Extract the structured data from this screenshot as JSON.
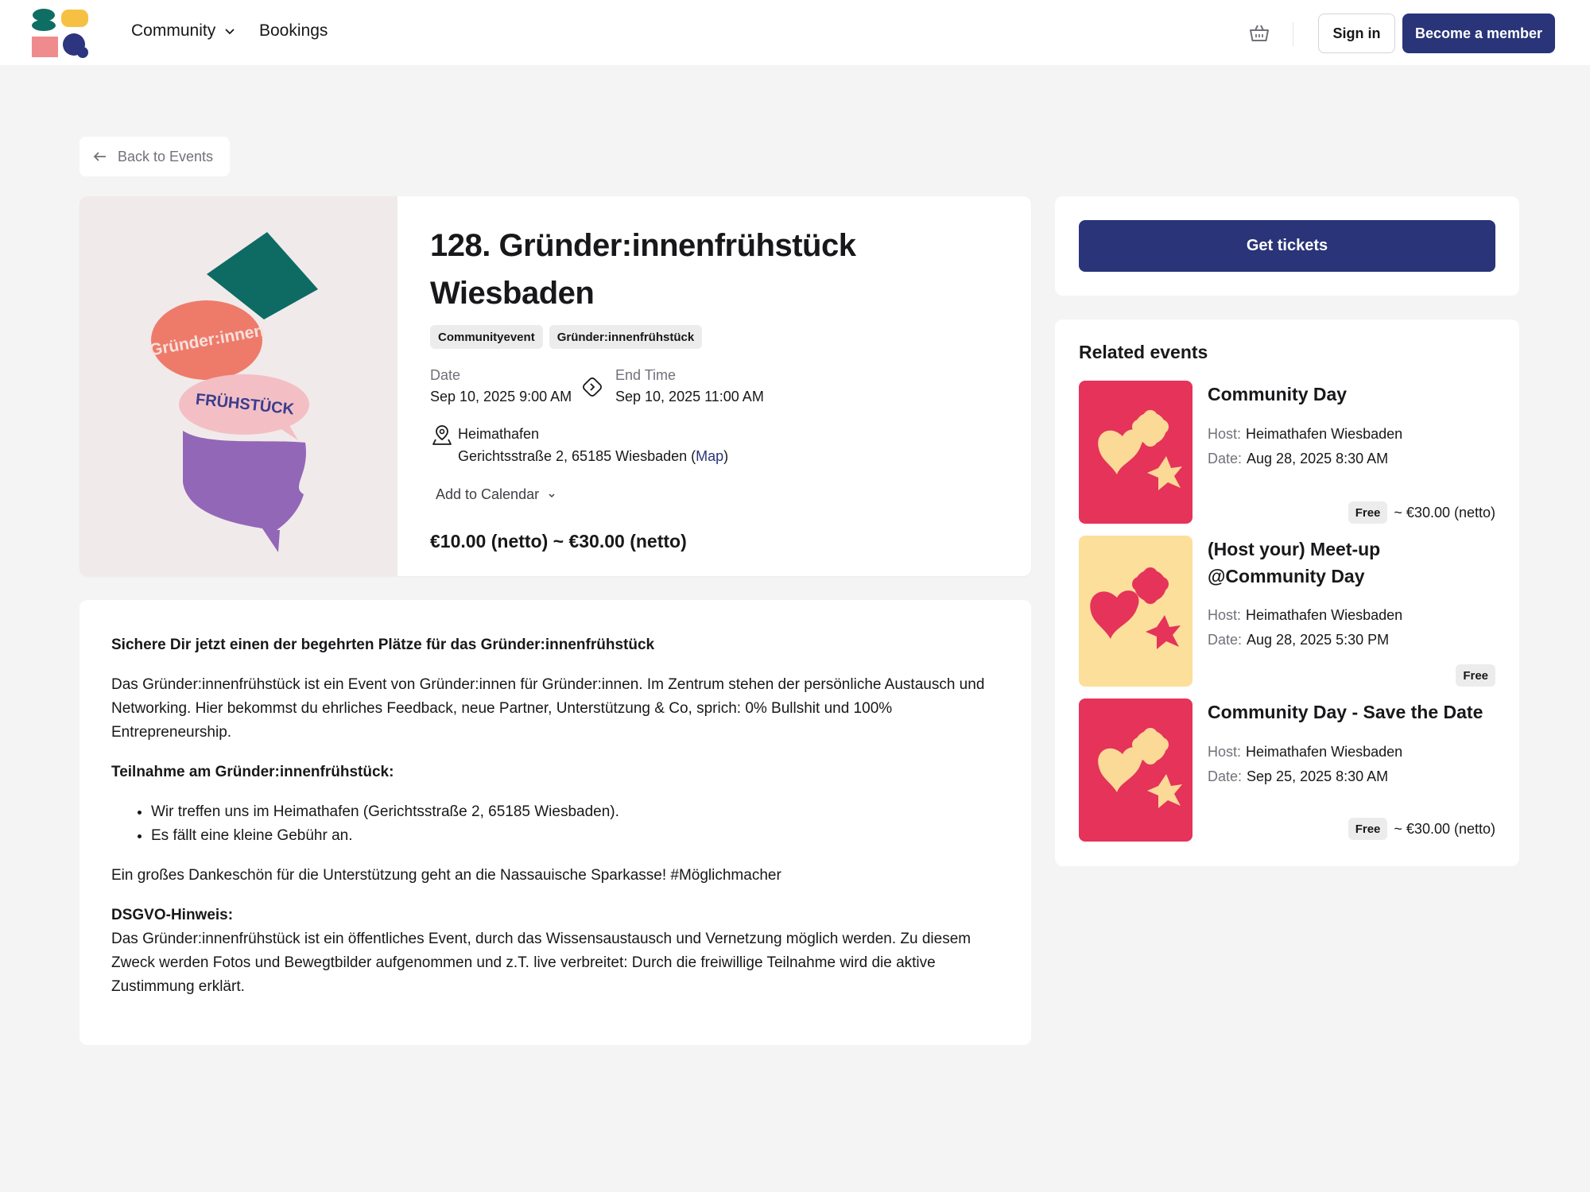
{
  "header": {
    "nav": {
      "community": "Community",
      "bookings": "Bookings"
    },
    "signin": "Sign in",
    "member": "Become a member"
  },
  "back": "Back to Events",
  "event": {
    "title": "128. Gründer:innenfrühstück Wiesbaden",
    "image_text": {
      "top": "Gründer:innen",
      "bottom": "FRÜHSTÜCK"
    },
    "tags": [
      "Communityevent",
      "Gründer:innenfrühstück"
    ],
    "date_label": "Date",
    "date_value": "Sep 10, 2025 9:00 AM",
    "end_label": "End Time",
    "end_value": "Sep 10, 2025 11:00 AM",
    "location_name": "Heimathafen",
    "location_address": "Gerichtsstraße 2, 65185 Wiesbaden (",
    "map_link": "Map",
    "location_close": ")",
    "add_to_calendar": "Add to Calendar",
    "price": "€10.00 (netto) ~ €30.00 (netto)"
  },
  "description": {
    "heading": "Sichere Dir jetzt einen der begehrten Plätze für das Gründer:innenfrühstück",
    "intro": "Das Gründer:innenfrühstück ist ein Event von Gründer:innen für Gründer:innen. Im Zentrum stehen der persönliche Austausch und Networking. Hier bekommst du ehrliches Feedback, neue Partner, Unterstützung & Co, sprich: 0% Bullshit und 100% Entrepreneurship.",
    "participation_heading": "Teilnahme am Gründer:innenfrühstück:",
    "bullets": [
      "Wir treffen uns im Heimathafen (Gerichtsstraße 2, 65185 Wiesbaden).",
      "Es fällt eine kleine Gebühr an."
    ],
    "thanks": "Ein großes Dankeschön für die Unterstützung geht an die Nassauische Sparkasse! #Möglichmacher",
    "dsgvo_heading": "DSGVO-Hinweis:",
    "dsgvo_text": "Das Gründer:innenfrühstück ist ein öffentliches Event, durch das Wissensaustausch und Vernetzung möglich werden. Zu diesem Zweck werden Fotos und Bewegtbilder aufgenommen und z.T. live verbreitet: Durch die freiwillige Teilnahme wird die aktive Zustimmung erklärt."
  },
  "tickets": {
    "button": "Get tickets"
  },
  "related": {
    "heading": "Related events",
    "host_key": "Host:",
    "date_key": "Date:",
    "items": [
      {
        "title": "Community Day",
        "host": "Heimathafen Wiesbaden",
        "date": "Aug 28, 2025 8:30 AM",
        "free": "Free",
        "price": "~ €30.00 (netto)",
        "thumb_bg": "#e5335a",
        "thumb_fg": "#fbd997"
      },
      {
        "title": "(Host your) Meet-up @Community Day",
        "host": "Heimathafen Wiesbaden",
        "date": "Aug 28, 2025 5:30 PM",
        "free": "Free",
        "price": "",
        "thumb_bg": "#fbdf9b",
        "thumb_fg": "#e5335a"
      },
      {
        "title": "Community Day - Save the Date",
        "host": "Heimathafen Wiesbaden",
        "date": "Sep 25, 2025 8:30 AM",
        "free": "Free",
        "price": "~ €30.00 (netto)",
        "thumb_bg": "#e5335a",
        "thumb_fg": "#fbd997"
      }
    ]
  },
  "colors": {
    "primary": "#293479",
    "background": "#f4f4f5"
  }
}
